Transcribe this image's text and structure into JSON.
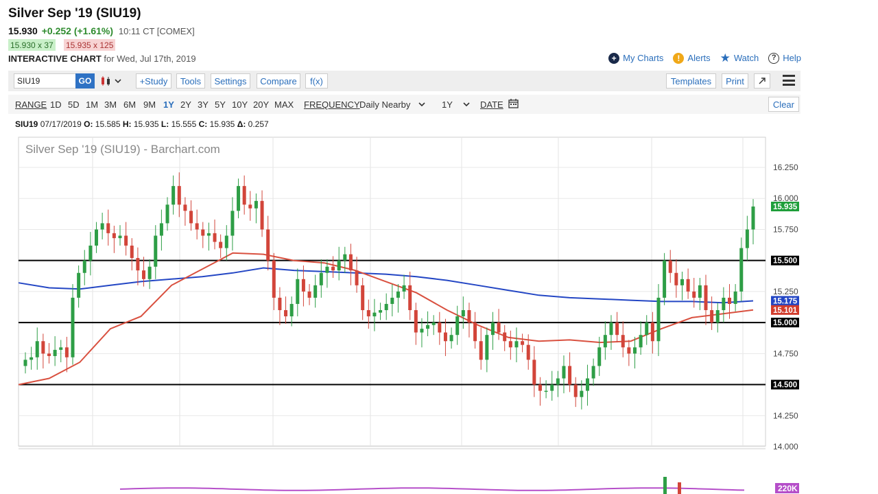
{
  "header": {
    "title": "Silver Sep '19 (SIU19)",
    "last": "15.930",
    "change": "+0.252 (+1.61%)",
    "time": "10:11 CT [COMEX]",
    "bid": "15.930 x 37",
    "ask": "15.935 x 125",
    "ic_label": "INTERACTIVE CHART",
    "ic_for": "for Wed, Jul 17th, 2019"
  },
  "links": {
    "my_charts": "My Charts",
    "alerts": "Alerts",
    "watch": "Watch",
    "help": "Help"
  },
  "toolbar": {
    "symbol": "SIU19",
    "go": "GO",
    "study": "+Study",
    "tools": "Tools",
    "settings": "Settings",
    "compare": "Compare",
    "fx": "f(x)",
    "templates": "Templates",
    "print": "Print",
    "expand_icon": "expand-arrow-icon",
    "menu_icon": "hamburger-icon"
  },
  "range_bar": {
    "range_label": "RANGE",
    "ranges": [
      "1D",
      "5D",
      "1M",
      "3M",
      "6M",
      "9M",
      "1Y",
      "2Y",
      "3Y",
      "5Y",
      "10Y",
      "20Y",
      "MAX"
    ],
    "active_range": "1Y",
    "frequency_label": "FREQUENCY",
    "frequency_value": "Daily Nearby",
    "period_value": "1Y",
    "date_label": "DATE",
    "clear": "Clear"
  },
  "ohlc": {
    "symbol": "SIU19",
    "date": "07/17/2019",
    "o_label": "O:",
    "o": "15.585",
    "h_label": "H:",
    "h": "15.935",
    "l_label": "L:",
    "l": "15.555",
    "c_label": "C:",
    "c": "15.935",
    "d_label": "Δ:",
    "d": "0.257"
  },
  "chart_data": {
    "type": "candlestick",
    "watermark": "Silver Sep '19 (SIU19) - Barchart.com",
    "y_ticks": [
      "16.250",
      "16.000",
      "15.750",
      "15.500",
      "15.250",
      "15.000",
      "14.750",
      "14.500",
      "14.250",
      "14.000"
    ],
    "ylim": [
      14.0,
      16.25
    ],
    "horizontal_levels": [
      15.5,
      15.0,
      14.5
    ],
    "price_tags": [
      {
        "label": "15.935",
        "value": 15.935,
        "color": "#1e9e3a"
      },
      {
        "label": "15.500",
        "value": 15.5,
        "color": "#000000"
      },
      {
        "label": "15.175",
        "value": 15.175,
        "color": "#2346c4"
      },
      {
        "label": "15.101",
        "value": 15.101,
        "color": "#d23c2c"
      },
      {
        "label": "15.000",
        "value": 15.0,
        "color": "#000000"
      },
      {
        "label": "14.500",
        "value": 14.5,
        "color": "#000000"
      }
    ],
    "ma_200_color": "#2346c4",
    "ma_50_color": "#d9503f",
    "up_color": "#2e9e46",
    "down_color": "#d2453a",
    "ma_200": [
      15.32,
      15.28,
      15.27,
      15.3,
      15.33,
      15.35,
      15.37,
      15.4,
      15.44,
      15.42,
      15.41,
      15.4,
      15.39,
      15.37,
      15.34,
      15.3,
      15.26,
      15.22,
      15.2,
      15.19,
      15.18,
      15.17,
      15.17,
      15.16,
      15.175
    ],
    "ma_50": [
      14.5,
      14.55,
      14.68,
      14.95,
      15.05,
      15.3,
      15.43,
      15.56,
      15.55,
      15.5,
      15.48,
      15.42,
      15.33,
      15.24,
      15.1,
      14.98,
      14.88,
      14.85,
      14.86,
      14.84,
      14.85,
      14.95,
      15.04,
      15.07,
      15.101
    ],
    "closes": [
      14.7,
      14.72,
      14.85,
      14.75,
      14.73,
      14.78,
      14.8,
      14.72,
      15.2,
      15.4,
      15.5,
      15.62,
      15.75,
      15.8,
      15.72,
      15.68,
      15.7,
      15.62,
      15.52,
      15.42,
      15.35,
      15.45,
      15.7,
      15.8,
      15.95,
      16.1,
      15.95,
      15.9,
      15.8,
      15.75,
      15.7,
      15.72,
      15.65,
      15.6,
      15.7,
      15.9,
      16.1,
      15.95,
      15.92,
      15.98,
      15.75,
      15.5,
      15.2,
      15.1,
      15.05,
      15.15,
      15.35,
      15.25,
      15.2,
      15.3,
      15.4,
      15.45,
      15.42,
      15.5,
      15.55,
      15.42,
      15.3,
      15.1,
      15.05,
      15.08,
      15.1,
      15.15,
      15.2,
      15.25,
      15.3,
      15.1,
      14.92,
      14.95,
      14.98,
      15.0,
      14.92,
      14.85,
      14.9,
      15.05,
      15.1,
      15.0,
      14.85,
      14.7,
      14.9,
      15.0,
      14.92,
      14.85,
      14.8,
      14.85,
      14.82,
      14.7,
      14.5,
      14.45,
      14.45,
      14.5,
      14.55,
      14.65,
      14.5,
      14.4,
      14.45,
      14.55,
      14.65,
      14.8,
      14.9,
      15.0,
      14.9,
      14.8,
      14.75,
      14.8,
      14.9,
      15.0,
      14.85,
      15.2,
      15.5,
      15.4,
      15.3,
      15.35,
      15.25,
      15.2,
      15.3,
      15.1,
      15.0,
      15.1,
      15.2,
      15.15,
      15.25,
      15.6,
      15.75,
      15.935
    ]
  }
}
